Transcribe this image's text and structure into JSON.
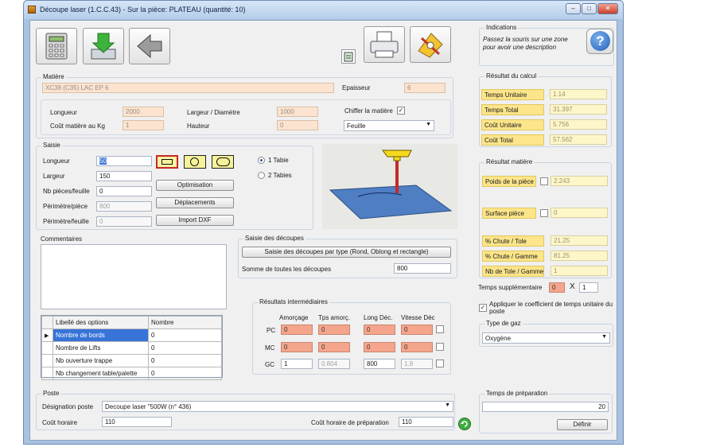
{
  "window": {
    "title": "Découpe laser  (1.C.C.43) - Sur la pièce: PLATEAU (quantité: 10)",
    "minimize": "–",
    "maximize": "□",
    "close": "✕"
  },
  "toolbar": {
    "calc_icon": "calculator-icon",
    "save_icon": "save-download-icon",
    "back_icon": "arrow-left-icon",
    "small_icon": "clipboard-icon",
    "print_icon": "printer-icon",
    "settings_icon": "tools-icon"
  },
  "matiere": {
    "group": "Matière",
    "name_value": "XC38 (C35) LAC EP 6",
    "epaisseur_label": "Epaisseur",
    "epaisseur_value": "6",
    "longueur_label": "Longueur",
    "longueur_value": "2000",
    "largeur_label": "Largeur / Diamètre",
    "largeur_value": "1000",
    "chiffrer_label": "Chiffer la matière",
    "chiffrer_checked": "✓",
    "cout_label": "Coût matière au Kg",
    "cout_value": "1",
    "hauteur_label": "Hauteur",
    "hauteur_value": "0",
    "type_value": "Feuille"
  },
  "saisie": {
    "group": "Saisie",
    "longueur_label": "Longueur",
    "longueur_value": "50",
    "largeur_label": "Largeur",
    "largeur_value": "150",
    "nb_label": "Nb pièces/feuille",
    "nb_value": "0",
    "perim_piece_label": "Périmètre/pièce",
    "perim_piece_value": "800",
    "perim_feuille_label": "Périmètre/feuille",
    "perim_feuille_value": "0",
    "btn_optimisation": "Optimisation",
    "btn_deplacements": "Déplacements",
    "btn_import": "Import DXF",
    "radio1": "1 Tabie",
    "radio2": "2 Tabies"
  },
  "commentaires": {
    "group": "Commentaires",
    "text": ""
  },
  "options_table": {
    "col1": "Libellé des options",
    "col2": "Nombre",
    "rows": [
      {
        "label": "Nombre de bords",
        "value": "0"
      },
      {
        "label": "Nombre de Lifts",
        "value": "0"
      },
      {
        "label": "Nb ouverture trappe",
        "value": "0"
      },
      {
        "label": "Nb changement table/palette",
        "value": "0"
      }
    ]
  },
  "decoupes": {
    "group": "Saisie des découpes",
    "button": "Saisie des découpes par type (Rond, Oblong et rectangle)",
    "somme_label": "Somme de toutes les découpes",
    "somme_value": "800"
  },
  "intermediaires": {
    "group": "Résultats intermédiaires",
    "headers": [
      "Amorçage",
      "Tps amorç.",
      "Long Déc.",
      "Vitesse Déc"
    ],
    "rows": [
      {
        "label": "PC",
        "values": [
          "0",
          "0",
          "0",
          "0"
        ]
      },
      {
        "label": "MC",
        "values": [
          "0",
          "0",
          "0",
          "0"
        ]
      },
      {
        "label": "GC",
        "values": [
          "1",
          "0.804",
          "800",
          "1.9"
        ]
      }
    ]
  },
  "poste": {
    "group": "Poste",
    "designation_label": "Désignation poste",
    "designation_value": "Decoupe laser \"500W (n° 436)",
    "cout_label": "Coût horaire",
    "cout_value": "110",
    "cout_prep_label": "Coût horaire de préparation",
    "cout_prep_value": "110"
  },
  "indications": {
    "group": "Indications",
    "text": "Passez la souris sur une zone pour avoir une description",
    "help_icon": "help-question-icon"
  },
  "calcul": {
    "group": "Résultat du calcul",
    "rows": [
      {
        "label": "Temps Unitaire",
        "value": "1.14"
      },
      {
        "label": "Temps Total",
        "value": "31.397"
      },
      {
        "label": "Coût Unitaire",
        "value": "5.756"
      },
      {
        "label": "Coût Total",
        "value": "57.562"
      }
    ]
  },
  "resultat_matiere": {
    "group": "Résultat matière",
    "poids_label": "Poids de la pièce",
    "poids_value": "2.243",
    "surface_label": "Surface pièce",
    "surface_value": "0",
    "chute_tole_label": "% Chute / Tole",
    "chute_tole_value": "21.25",
    "chute_gamme_label": "% Chute / Gamme",
    "chute_gamme_value": "81.25",
    "nb_tole_label": "Nb de Tole / Gamme",
    "nb_tole_value": "1"
  },
  "supplementaire": {
    "label": "Temps supplémentaire",
    "value": "0",
    "x": "X",
    "mult": "1"
  },
  "coef": {
    "label": "Appliquer le coefficient de temps unitaire du poste",
    "checked": "✓"
  },
  "gaz": {
    "group": "Type de gaz",
    "value": "Oxygène"
  },
  "preparation": {
    "group": "Temps de préparation",
    "value": "20",
    "button": "Définir"
  }
}
